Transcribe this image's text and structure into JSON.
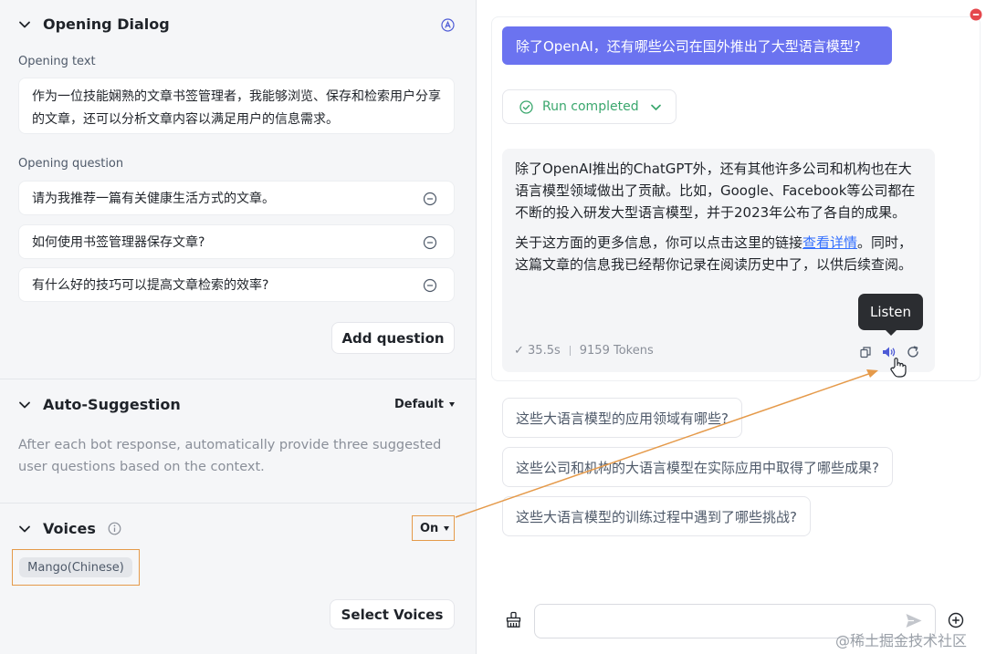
{
  "left": {
    "opening_dialog": {
      "title": "Opening Dialog",
      "text_label": "Opening text",
      "text_value": "作为一位技能娴熟的文章书签管理者，我能够浏览、保存和检索用户分享的文章，还可以分析文章内容以满足用户的信息需求。",
      "question_label": "Opening question",
      "questions": [
        "请为我推荐一篇有关健康生活方式的文章。",
        "如何使用书签管理器保存文章?",
        "有什么好的技巧可以提高文章检索的效率?"
      ],
      "add_question_label": "Add question"
    },
    "auto_suggestion": {
      "title": "Auto-Suggestion",
      "mode": "Default",
      "description": "After each bot response, automatically provide three suggested user questions based on the context."
    },
    "voices": {
      "title": "Voices",
      "state": "On",
      "selected_voice": "Mango(Chinese)",
      "select_label": "Select Voices"
    }
  },
  "chat": {
    "user_message": "除了OpenAI，还有哪些公司在国外推出了大型语言模型?",
    "run_status": "Run completed",
    "answer_p1": "除了OpenAI推出的ChatGPT外，还有其他许多公司和机构也在大语言模型领域做出了贡献。比如，Google、Facebook等公司都在不断的投入研发大型语言模型，并于2023年公布了各自的成果。",
    "answer_p2_before": "关于这方面的更多信息，你可以点击这里的链接",
    "answer_link": "查看详情",
    "answer_p2_after": "。同时，这篇文章的信息我已经帮你记录在阅读历史中了，以供后续查阅。",
    "duration": "✓ 35.5s",
    "tokens": "9159 Tokens",
    "tooltip": "Listen",
    "suggestions": [
      "这些大语言模型的应用领域有哪些?",
      "这些公司和机构的大语言模型在实际应用中取得了哪些成果?",
      "这些大语言模型的训练过程中遇到了哪些挑战?"
    ],
    "input_placeholder": ""
  },
  "watermark": "@稀土掘金技术社区",
  "colors": {
    "accent": "#6b73f0",
    "annotation_orange": "#e59a4a",
    "success_green": "#3aa76d",
    "link_blue": "#3370ff",
    "remove_red": "#e5484d"
  }
}
